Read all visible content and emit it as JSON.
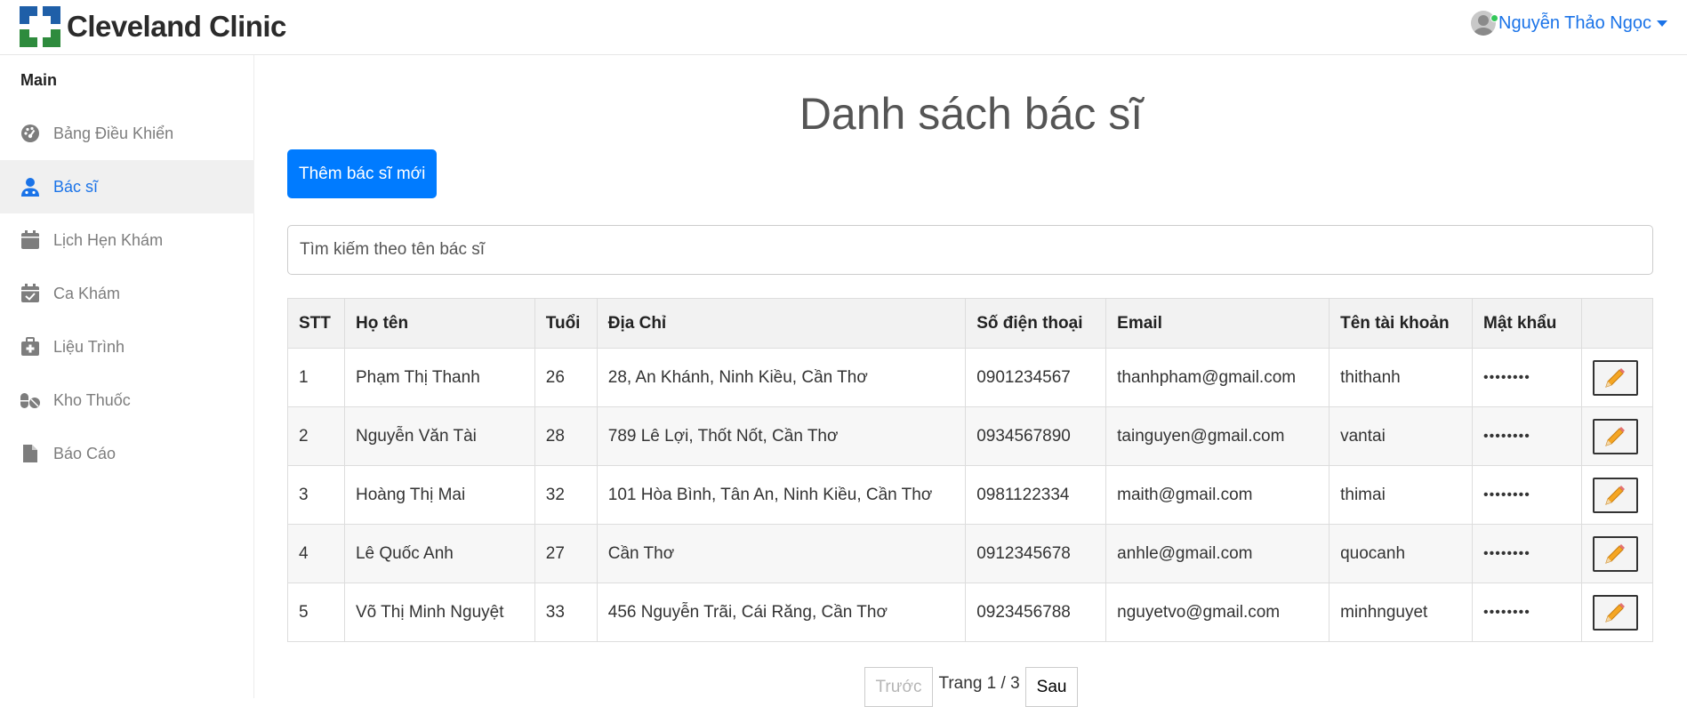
{
  "brand": {
    "name": "Cleveland Clinic",
    "colors": {
      "blue": "#1f5fa8",
      "green": "#2e8b3d"
    }
  },
  "user": {
    "name": "Nguyễn Thảo Ngọc",
    "status_color": "#34c759"
  },
  "sidebar": {
    "section_title": "Main",
    "items": [
      {
        "label": "Bảng Điều Khiển",
        "icon": "dashboard-icon"
      },
      {
        "label": "Bác sĩ",
        "icon": "doctor-icon",
        "active": true
      },
      {
        "label": "Lịch Hẹn Khám",
        "icon": "calendar-icon"
      },
      {
        "label": "Ca Khám",
        "icon": "calendar-check-icon"
      },
      {
        "label": "Liệu Trình",
        "icon": "medical-kit-icon"
      },
      {
        "label": "Kho Thuốc",
        "icon": "pills-icon"
      },
      {
        "label": "Báo Cáo",
        "icon": "file-icon"
      }
    ]
  },
  "main": {
    "title": "Danh sách bác sĩ",
    "add_button": "Thêm bác sĩ mới",
    "search_placeholder": "Tìm kiếm theo tên bác sĩ",
    "table": {
      "headers": [
        "STT",
        "Họ tên",
        "Tuổi",
        "Địa Chỉ",
        "Số điện thoại",
        "Email",
        "Tên tài khoản",
        "Mật khẩu"
      ],
      "rows": [
        [
          "1",
          "Phạm Thị Thanh",
          "26",
          "28, An Khánh, Ninh Kiều, Cần Thơ",
          "0901234567",
          "thanhpham@gmail.com",
          "thithanh",
          "••••••••"
        ],
        [
          "2",
          "Nguyễn Văn Tài",
          "28",
          "789 Lê Lợi, Thốt Nốt, Cần Thơ",
          "0934567890",
          "tainguyen@gmail.com",
          "vantai",
          "••••••••"
        ],
        [
          "3",
          "Hoàng Thị Mai",
          "32",
          "101 Hòa Bình, Tân An, Ninh Kiều, Cần Thơ",
          "0981122334",
          "maith@gmail.com",
          "thimai",
          "••••••••"
        ],
        [
          "4",
          "Lê Quốc Anh",
          "27",
          "Cần Thơ",
          "0912345678",
          "anhle@gmail.com",
          "quocanh",
          "••••••••"
        ],
        [
          "5",
          "Võ Thị Minh Nguyệt",
          "33",
          "456 Nguyễn Trãi, Cái Răng, Cần Thơ",
          "0923456788",
          "nguyetvo@gmail.com",
          "minhnguyet",
          "••••••••"
        ]
      ]
    },
    "pagination": {
      "prev": "Trước",
      "info": "Trang 1 / 3",
      "next": "Sau"
    }
  }
}
